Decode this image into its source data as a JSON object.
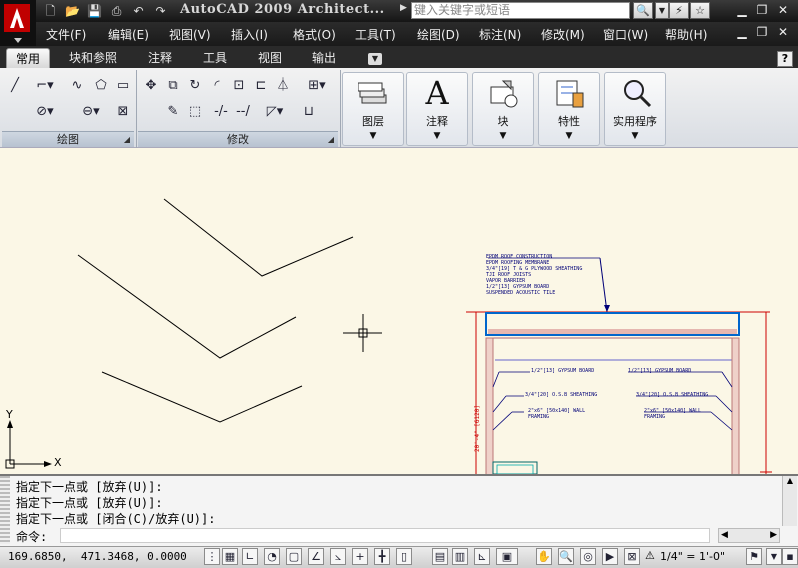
{
  "title": "AutoCAD 2009 Architect...",
  "search": {
    "placeholder": "键入关键字或短语"
  },
  "menu": [
    "文件(F)",
    "编辑(E)",
    "视图(V)",
    "插入(I)",
    "格式(O)",
    "工具(T)",
    "绘图(D)",
    "标注(N)",
    "修改(M)",
    "窗口(W)",
    "帮助(H)"
  ],
  "ribbon_tabs": [
    "常用",
    "块和参照",
    "注释",
    "工具",
    "视图",
    "输出"
  ],
  "ribbon_panels": {
    "draw": "绘图",
    "modify": "修改"
  },
  "big_buttons": [
    "图层",
    "注释",
    "块",
    "特性",
    "实用程序"
  ],
  "help_label": "?",
  "drawing": {
    "annotation_block": [
      "EPDM ROOF CONSTRUCTION",
      "EPDM ROOFING MEMBRANE",
      "3/4\"[19] T & G PLYWOOD SHEATHING",
      "TJI ROOF JOISTS",
      "VAPOR BARRIER",
      "1/2\"[13] GYPSUM BOARD",
      "SUSPENDED ACOUSTIC TILE"
    ],
    "labels": [
      "1/2\"[13] GYPSUM BOARD",
      "1/2\"[13] GYPSUM BOARD",
      "3/4\"[20] O.S.B SHEATHING",
      "3/4\"[20] O.S.B SHEATHING",
      "2\"x6\" [50x140] WALL FRAMING",
      "2\"x6\" [50x140] WALL FRAMING"
    ],
    "dimension": "20'-4\" [6120]",
    "ucs_x": "X",
    "ucs_y": "Y"
  },
  "command": {
    "history": [
      "指定下一点或 [放弃(U)]:",
      "指定下一点或 [放弃(U)]:",
      "指定下一点或 [闭合(C)/放弃(U)]:"
    ],
    "prompt": "命令:"
  },
  "status": {
    "coords": "169.6850,  471.3468, 0.0000",
    "scale": "1/4\" = 1'-0\""
  }
}
